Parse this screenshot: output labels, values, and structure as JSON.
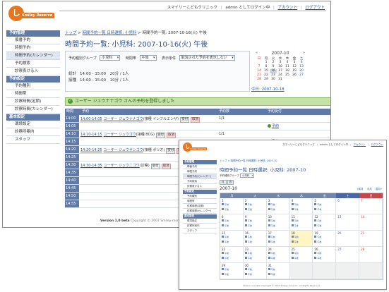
{
  "back": {
    "logo": {
      "mark": "し",
      "text": "Smiley Reserve"
    },
    "toplinks": {
      "clinic": "スマイリーこどもクリニック",
      "login": "admin としてログイン中",
      "account": "アカウント",
      "logout": "ログアウト"
    },
    "sidebar": [
      {
        "head": "予約管理",
        "items": [
          "順番予約",
          "時間予約",
          "時間予約(カレンダー)",
          "予約検索",
          "診察表ける入"
        ]
      },
      {
        "head": "予約設定",
        "items": [
          "予約種別",
          "時間帯",
          "診察時間(定期)",
          "診察時間(カレンダー)"
        ]
      },
      {
        "head": "基本設定",
        "items": [
          "環境設定",
          "診察所案内",
          "スタッフ"
        ]
      }
    ],
    "breadcrumb": {
      "top": "トップ",
      "l1": "時間予約一覧 日時選択: 小児科",
      "current": "時間予約一覧: 2007-10-16(火) 午後"
    },
    "title": "時間予約一覧: 小児科: 2007-10-16(火) 午後",
    "filter": {
      "group_label": "予約種別グループ",
      "group_value": "小児科",
      "slot_label": "時間帯",
      "slot_value": "午後",
      "display_label": "表示条件",
      "display_value": "取消された予約を表示しない"
    },
    "totals": {
      "total_label": "総計",
      "total_value": "14:00 - 15:00　20分 / 1人",
      "vacc_label": "接種",
      "vacc_value": "14:00 - 15:00　10分 / 1人"
    },
    "mini_cal": {
      "month": "2007-10",
      "prev": "«",
      "next": "»",
      "days": [
        "日",
        "月",
        "火",
        "水",
        "木",
        "金",
        "土"
      ],
      "weeks": [
        [
          "",
          "1",
          "2",
          "3",
          "4",
          "5",
          "6"
        ],
        [
          "7",
          "8",
          "9",
          "10",
          "11",
          "12",
          "13"
        ],
        [
          "14",
          "15",
          "16",
          "17",
          "18",
          "19",
          "20"
        ],
        [
          "21",
          "22",
          "23",
          "24",
          "25",
          "26",
          "27"
        ],
        [
          "28",
          "29",
          "30",
          "31",
          "",
          "",
          ""
        ]
      ],
      "selected": "16",
      "today": "今日: 2007-10-18"
    },
    "flash": "ユーザー ジュウナナゴウ さんの予約を登録しました",
    "schedule": {
      "headers": {
        "time": "時間",
        "entry": "予約",
        "count": "予約数",
        "reserve": "予約受付"
      },
      "rows": [
        {
          "time": "14:00",
          "span": "14:00-14:05",
          "name": "ユーザー ジュウナナゴウ",
          "kind": "(接種 インフルエンザ)",
          "count": "1/1"
        },
        {
          "time": "14:05",
          "span": "",
          "name": "",
          "kind": "",
          "count": "",
          "reserve": "予約"
        },
        {
          "time": "14:10",
          "span": "14:10-14:15",
          "name": "ユーザー ジュウゴウ",
          "kind": "(接種 BCG)",
          "count": "1/1"
        },
        {
          "time": "14:15",
          "span": "",
          "name": "",
          "kind": "",
          "count": "",
          "reserve": "予約"
        },
        {
          "time": "14:20",
          "span": "14:20-14:25",
          "name": "ユーザー ジュウサンゴウ",
          "kind": "(接種 ポリオ)",
          "count": "1/1"
        },
        {
          "time": "14:25",
          "span": "",
          "name": "",
          "kind": "",
          "count": "",
          "reserve": "予約"
        },
        {
          "time": "14:30",
          "span": "14:30-14:35",
          "name": "ユーザー ジュウニゴウ",
          "kind": "(診察)",
          "count": "1/1"
        },
        {
          "time": "14:35",
          "span": "",
          "name": "",
          "kind": "",
          "count": "",
          "reserve": ""
        },
        {
          "time": "14:40",
          "span": "",
          "name": "",
          "kind": "",
          "count": "",
          "reserve": ""
        },
        {
          "time": "14:45",
          "span": "",
          "name": "",
          "kind": "",
          "count": "",
          "reserve": ""
        },
        {
          "time": "14:50",
          "span": "",
          "name": "",
          "kind": "",
          "count": "",
          "reserve": ""
        },
        {
          "time": "14:55",
          "span": "",
          "name": "",
          "kind": "",
          "count": "",
          "reserve": ""
        }
      ],
      "accept_btn": "受付",
      "cancel_btn": "取消"
    },
    "footer": {
      "version": "Version 1.0 beta",
      "copy": "Copyright © 2007 Smiley-more Inc."
    }
  },
  "front": {
    "logo": {
      "mark": "し",
      "text": "Smiley Reserve"
    },
    "toplinks": {
      "clinic": "スマイリーこどもクリニック",
      "login": "admin としてログイン中",
      "account": "アカウント",
      "logout": "ログアウト"
    },
    "sidebar": [
      {
        "head": "予約管理",
        "items": [
          "順番予約",
          "時間予約",
          "時間予約(カレンダー)",
          "予約検索",
          "診察表ける入"
        ]
      },
      {
        "head": "予約設定",
        "items": [
          "予約種別",
          "時間帯",
          "診察時間(定期)",
          "診察時間(カレンダー)"
        ]
      },
      {
        "head": "基本設定",
        "items": [
          "環境設定",
          "診察所案内",
          "スタッフ"
        ]
      }
    ],
    "breadcrumb": "トップ > 時間予約一覧 日時選択: 小児科: 2007-10",
    "title": "時間予約一覧 日時選択: 小児科: 2007-10",
    "filter": {
      "label": "予約種別グループ",
      "value": "小児科"
    },
    "tabs": [
      "月",
      "週"
    ],
    "cal_title": "2007-10",
    "cal_nav": [
      "«前月",
      "今月",
      "翌月»"
    ],
    "days": [
      "月",
      "火",
      "水",
      "木",
      "金",
      "土",
      "日"
    ],
    "weeks": [
      [
        "1",
        "2",
        "3",
        "4",
        "5",
        "6",
        "7"
      ],
      [
        "8",
        "9",
        "10",
        "11",
        "12",
        "13",
        "14"
      ],
      [
        "15",
        "16",
        "17",
        "18",
        "19",
        "20",
        "21"
      ],
      [
        "22",
        "23",
        "24",
        "25",
        "26",
        "27",
        "28"
      ],
      [
        "29",
        "30",
        "31",
        "",
        "",
        "",
        ""
      ]
    ],
    "today": "18",
    "slot_am": "午前",
    "slot_pm": "午後",
    "footer": "Version 1.0 beta  Copyright © 2007 Smiley-more Inc. All Rights Reserved."
  }
}
